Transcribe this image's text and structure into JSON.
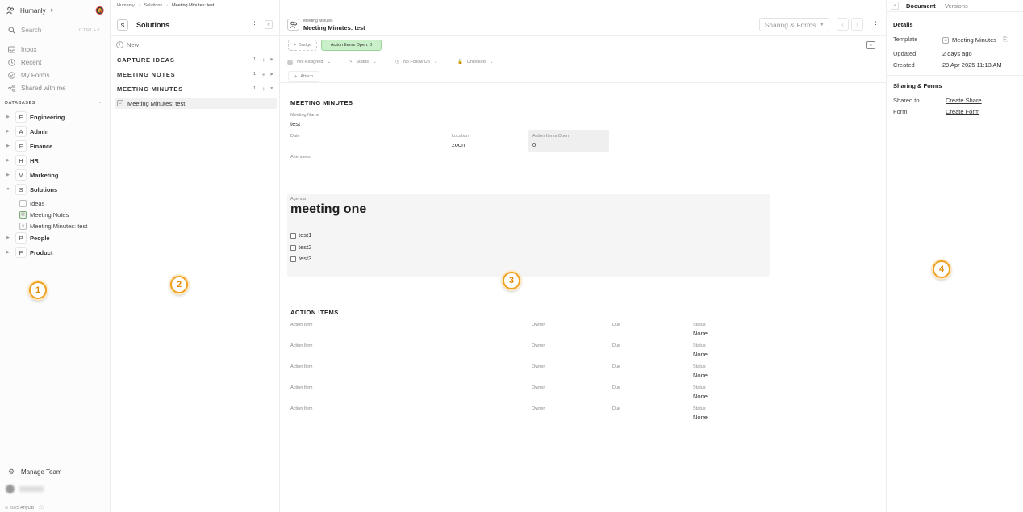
{
  "workspace": {
    "name": "Humanly"
  },
  "search": {
    "placeholder": "Search",
    "shortcut": "CTRL+K"
  },
  "nav": [
    {
      "label": "Inbox",
      "icon": "inbox-icon"
    },
    {
      "label": "Recent",
      "icon": "clock-icon"
    },
    {
      "label": "My Forms",
      "icon": "forms-icon"
    },
    {
      "label": "Shared with me",
      "icon": "share-icon"
    }
  ],
  "databases_header": "DATABASES",
  "databases": [
    {
      "letter": "E",
      "name": "Engineering"
    },
    {
      "letter": "A",
      "name": "Admin"
    },
    {
      "letter": "F",
      "name": "Finance"
    },
    {
      "letter": "H",
      "name": "HR"
    },
    {
      "letter": "M",
      "name": "Marketing"
    },
    {
      "letter": "S",
      "name": "Solutions"
    }
  ],
  "solutions_children": [
    {
      "label": "Ideas"
    },
    {
      "label": "Meeting Notes"
    },
    {
      "label": "Meeting Minutes: test"
    }
  ],
  "databases_after": [
    {
      "letter": "P",
      "name": "People"
    },
    {
      "letter": "P",
      "name": "Product"
    }
  ],
  "manage_team": "Manage Team",
  "footer": "© 2025 AnyDB",
  "breadcrumb": [
    "Humanly",
    "Solutions",
    "Meeting Minutes: test"
  ],
  "col2": {
    "letter": "S",
    "title": "Solutions",
    "new_label": "New",
    "sections": [
      {
        "label": "CAPTURE IDEAS",
        "count": "1"
      },
      {
        "label": "MEETING NOTES",
        "count": "1"
      },
      {
        "label": "MEETING MINUTES",
        "count": "1"
      }
    ],
    "item": "Meeting Minutes: test"
  },
  "doc": {
    "small_title": "Meeting Minutes",
    "title": "Meeting Minutes: test",
    "sharing_button": "Sharing & Forms",
    "badge_label": "Badge",
    "action_items_open_badge": "Action Items Open: 0",
    "filters": [
      "Not Assigned",
      "Status",
      "No Follow Up",
      "Unlocked"
    ],
    "attach": "Attach",
    "section_title": "MEETING MINUTES",
    "meeting_name_label": "Meeting Name",
    "meeting_name": "test",
    "date_label": "Date",
    "location_label": "Location",
    "location": "zoom",
    "action_open_label": "Action Items Open",
    "action_open": "0",
    "attendees_label": "Attendees",
    "agenda_label": "Agenda",
    "agenda_title": "meeting one",
    "checklist": [
      "test1",
      "test2",
      "test3"
    ],
    "action_items_title": "ACTION ITEMS",
    "action_items_cols": {
      "item": "Action Item",
      "owner": "Owner",
      "due": "Due",
      "status": "Status"
    },
    "action_items_rows": [
      {
        "status": "None"
      },
      {
        "status": "None"
      },
      {
        "status": "None"
      },
      {
        "status": "None"
      },
      {
        "status": "None"
      }
    ]
  },
  "right": {
    "tabs": [
      "Document",
      "Versions"
    ],
    "details_title": "Details",
    "template_label": "Template",
    "template_value": "Meeting Minutes",
    "updated_label": "Updated",
    "updated_value": "2 days ago",
    "created_label": "Created",
    "created_value": "29 Apr 2025 11:13 AM",
    "sharing_title": "Sharing & Forms",
    "shared_to_label": "Shared to",
    "shared_to_link": "Create Share",
    "form_label": "Form",
    "form_link": "Create Form"
  },
  "annotations": [
    "1",
    "2",
    "3",
    "4"
  ],
  "colors": {
    "accent_badge": "#c9f0c9",
    "annotation": "#f0a020"
  }
}
